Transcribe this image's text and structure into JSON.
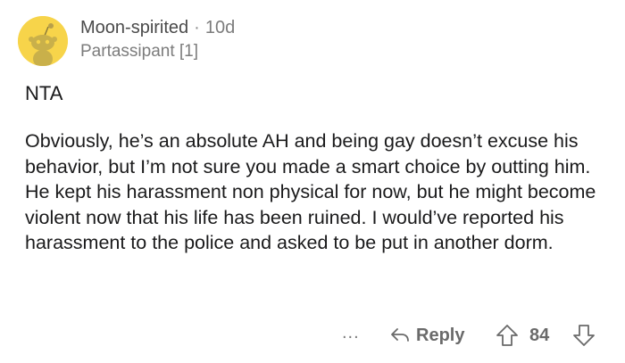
{
  "comment": {
    "author": "Moon-spirited",
    "separator": "·",
    "age": "10d",
    "flair": "Partassipant [1]",
    "verdict": "NTA",
    "body": "Obviously, he’s an absolute AH and being gay doesn’t excuse his behavior, but I’m not sure you made a smart choice by outting him. He kept his harassment non physical for now, but he might become violent now that his life has been ruined. I would’ve reported his harassment to the police and asked to be put in another dorm."
  },
  "actions": {
    "more_label": "...",
    "reply_label": "Reply",
    "score": "84"
  },
  "icons": {
    "avatar": "snoo-avatar-icon",
    "reply": "reply-arrow-icon",
    "upvote": "upvote-arrow-icon",
    "downvote": "downvote-arrow-icon"
  },
  "colors": {
    "avatar_bg": "#f7d44a",
    "text": "#1a1a1b",
    "muted": "#7c7c7c"
  }
}
